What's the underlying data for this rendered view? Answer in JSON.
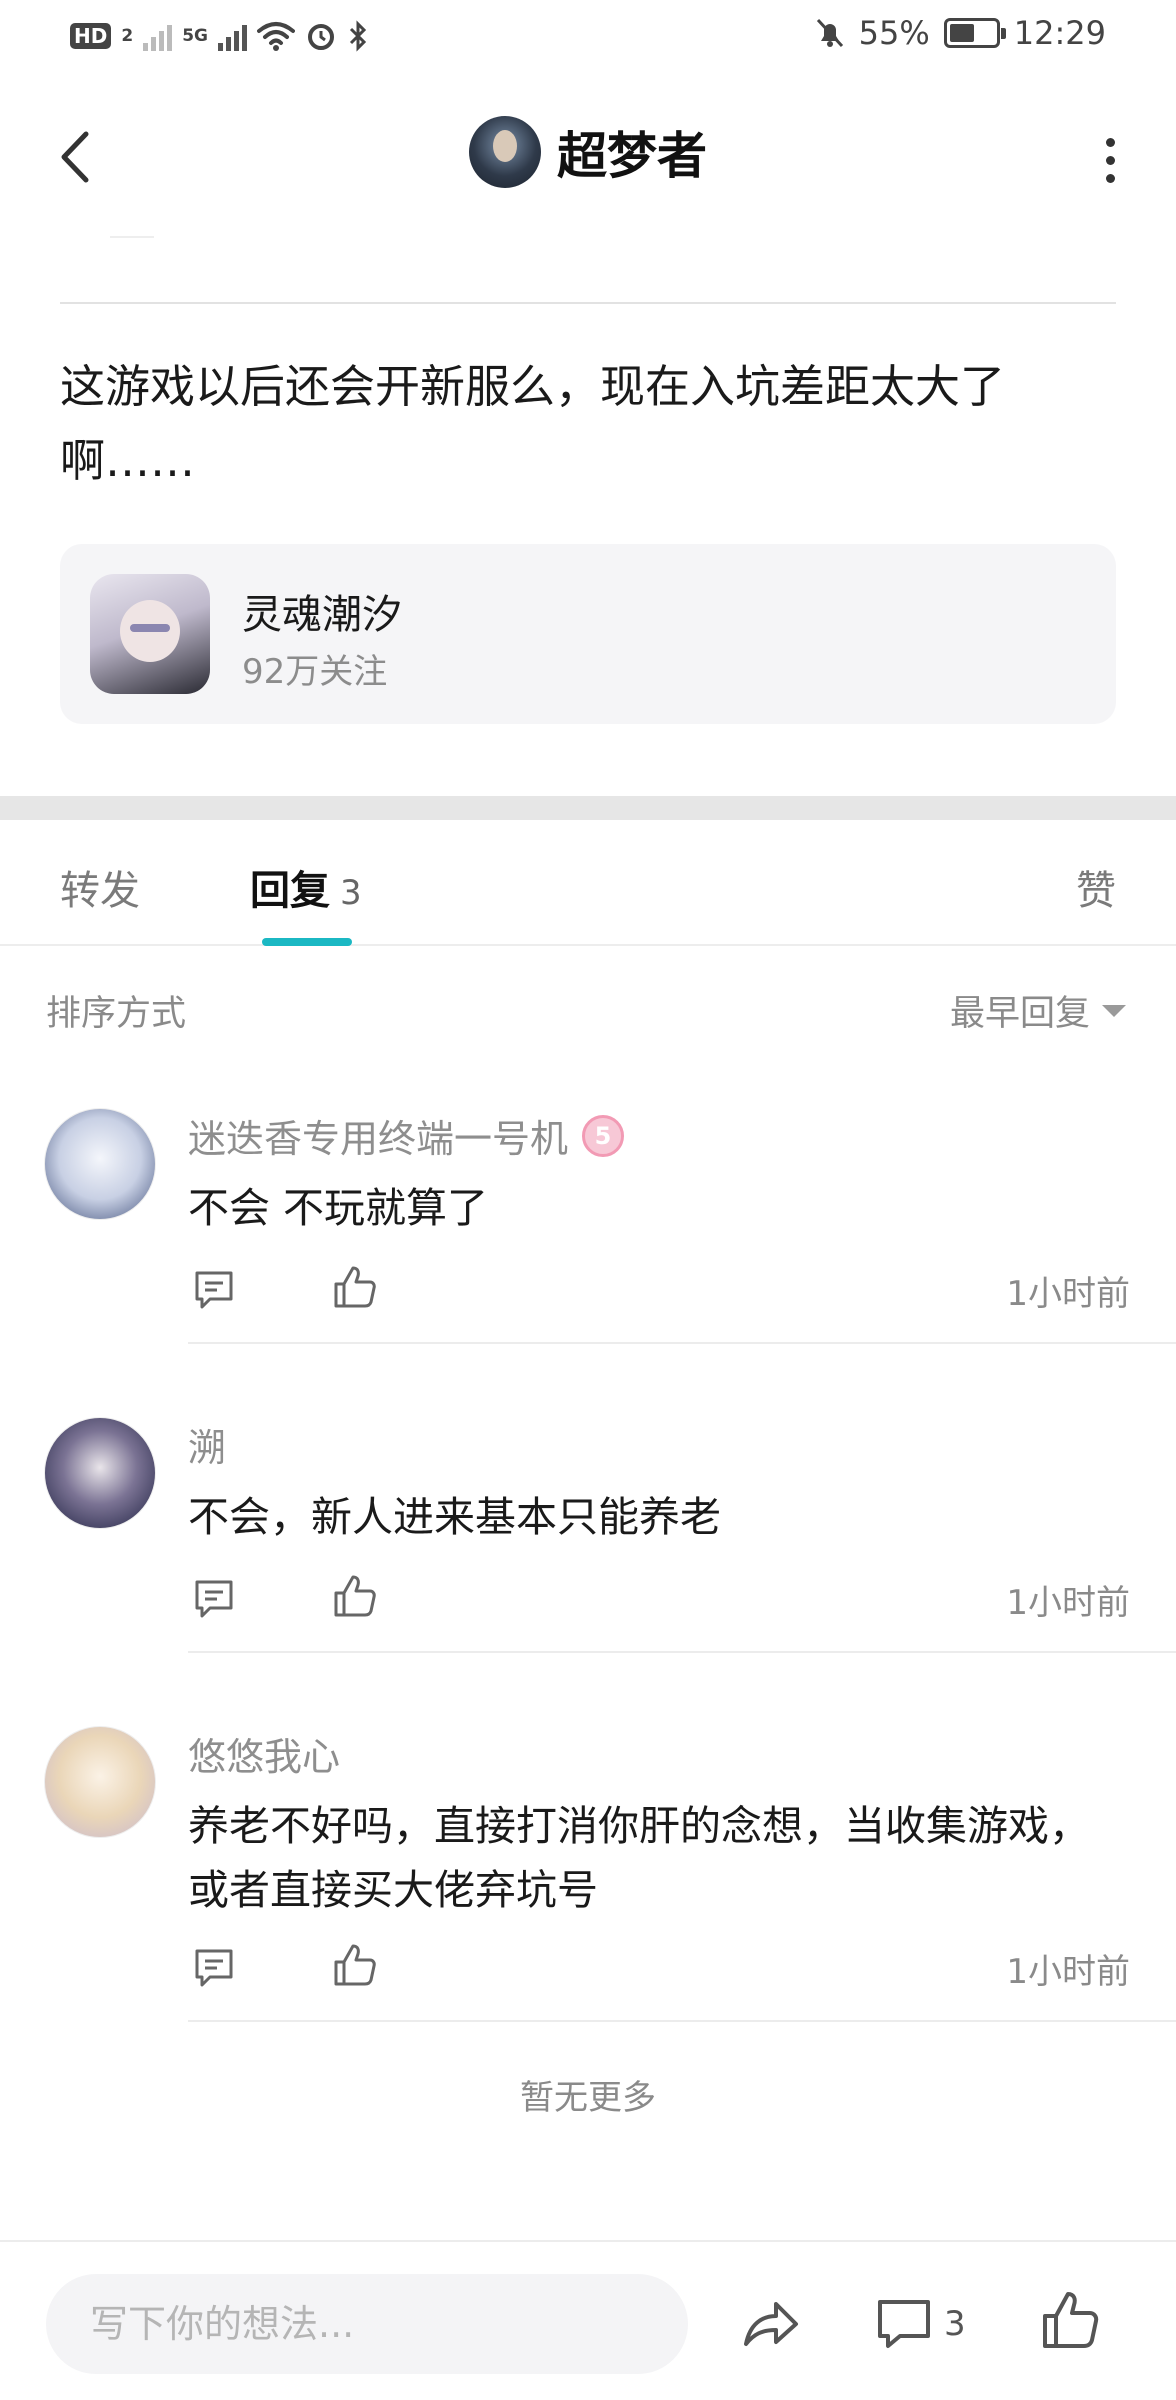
{
  "status_bar": {
    "hd_label": "HD",
    "sim_label": "2",
    "network_label": "5G",
    "battery_percent": "55%",
    "battery_level": 0.55,
    "time": "12:29",
    "icons": [
      "signal-icon",
      "wifi-icon",
      "alarm-icon",
      "bluetooth-icon",
      "mute-icon",
      "battery-icon"
    ]
  },
  "header": {
    "title": "超梦者",
    "back_icon": "chevron-left-icon",
    "more_icon": "more-vertical-icon"
  },
  "post": {
    "text": "这游戏以后还会开新服么，现在入坑差距太大了啊……",
    "game": {
      "name": "灵魂潮汐",
      "followers": "92万关注"
    }
  },
  "tabs": {
    "forward": "转发",
    "reply": "回复",
    "reply_count": "3",
    "like": "赞"
  },
  "sort": {
    "label": "排序方式",
    "selected": "最早回复"
  },
  "comments": [
    {
      "username": "迷迭香专用终端一号机",
      "level": "5",
      "text": "不会 不玩就算了",
      "time": "1小时前"
    },
    {
      "username": "溯",
      "text": "不会，新人进来基本只能养老",
      "time": "1小时前"
    },
    {
      "username": "悠悠我心",
      "text": "养老不好吗，直接打消你肝的念想，当收集游戏，或者直接买大佬弃坑号",
      "time": "1小时前"
    }
  ],
  "footer_note": "暂无更多",
  "bottom_bar": {
    "input_placeholder": "写下你的想法...",
    "comment_count": "3"
  },
  "colors": {
    "accent": "#1bb8c3",
    "muted_text": "#8a8a8a",
    "card_bg": "#f5f5f7"
  }
}
